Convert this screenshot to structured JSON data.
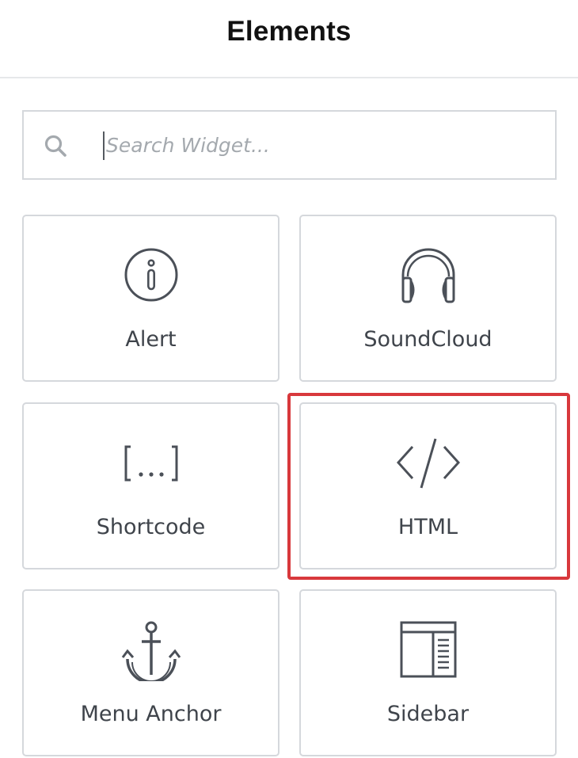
{
  "panel": {
    "title": "Elements"
  },
  "search": {
    "placeholder": "Search Widget...",
    "value": ""
  },
  "widgets": [
    {
      "label": "Alert",
      "icon": "info-circle-icon"
    },
    {
      "label": "SoundCloud",
      "icon": "headphones-icon"
    },
    {
      "label": "Shortcode",
      "icon": "shortcode-brackets-icon"
    },
    {
      "label": "HTML",
      "icon": "code-icon",
      "highlighted": true
    },
    {
      "label": "Menu Anchor",
      "icon": "anchor-icon"
    },
    {
      "label": "Sidebar",
      "icon": "sidebar-layout-icon"
    }
  ],
  "colors": {
    "icon": "#4b5058",
    "border": "#d5d8dc",
    "highlight": "#d8383c",
    "title": "#111111"
  }
}
